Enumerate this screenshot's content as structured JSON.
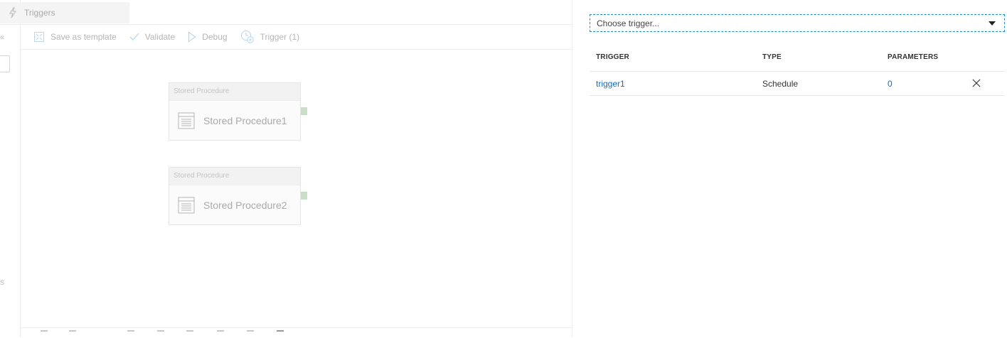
{
  "tab": {
    "label": "Triggers",
    "icon": "lightning-icon"
  },
  "toolbar": {
    "save_template": "Save as template",
    "validate": "Validate",
    "debug": "Debug",
    "trigger": "Trigger (1)"
  },
  "activities": [
    {
      "type": "Stored Procedure",
      "name": "Stored Procedure1"
    },
    {
      "type": "Stored Procedure",
      "name": "Stored Procedure2"
    }
  ],
  "trigger_panel": {
    "dropdown_placeholder": "Choose trigger...",
    "columns": [
      "TRIGGER",
      "TYPE",
      "PARAMETERS"
    ],
    "rows": [
      {
        "trigger": "trigger1",
        "type": "Schedule",
        "parameters": "0"
      }
    ]
  },
  "colors": {
    "accent": "#0f6cbd",
    "dropdown_border": "#1b8ec9",
    "connector": "#c8dec6"
  }
}
